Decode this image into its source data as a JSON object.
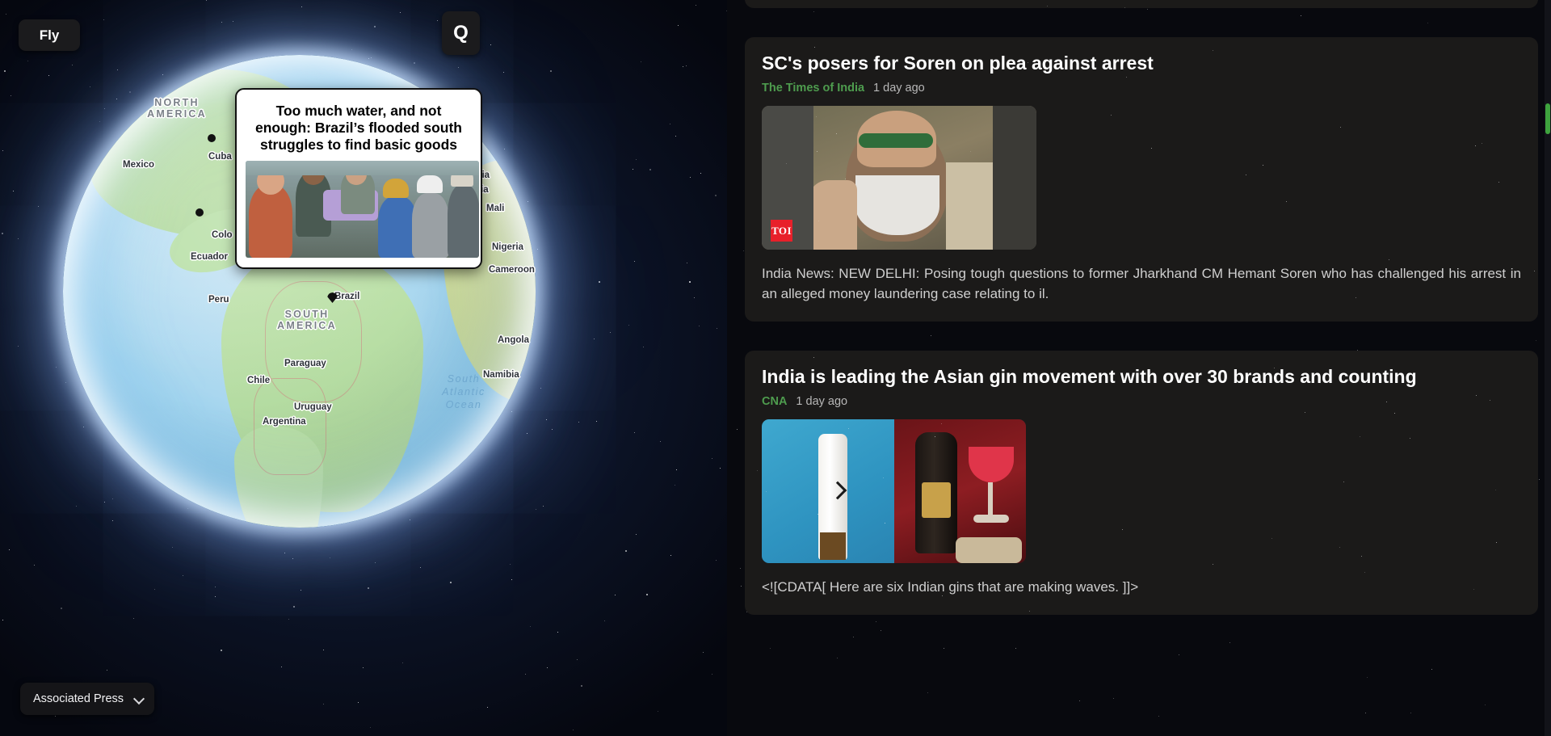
{
  "app": {
    "fly_button": "Fly",
    "q_button": "Q",
    "source_select": {
      "value": "Associated Press",
      "chevron_icon": "chevron-down-icon"
    },
    "accent_green": "#4e9c4e",
    "panel_background": "#1b1a19",
    "scrollbar_color": "#3ea33e"
  },
  "map": {
    "popup": {
      "title": "Too much water, and not enough: Brazil’s flooded south struggles to find basic goods",
      "image_alt": "Rescue workers and residents seated in a boat during flooding"
    },
    "continent_labels": [
      {
        "text": "NORTH AMERICA",
        "line1": "NORTH",
        "line2": "AMERICA"
      },
      {
        "text": "SOUTH AMERICA",
        "line1": "SOUTH",
        "line2": "AMERICA"
      }
    ],
    "ocean_labels": [
      {
        "line1": "South",
        "line2": "Atlantic",
        "line3": "Ocean"
      }
    ],
    "country_labels": [
      "Mexico",
      "Cuba",
      "Colo",
      "Ecuador",
      "Peru",
      "Brazil",
      "Paraguay",
      "Chile",
      "Uruguay",
      "Argentina",
      "ria",
      "nia",
      "Mali",
      "Nigeria",
      "Cameroon",
      "Angola",
      "Namibia"
    ]
  },
  "news": {
    "articles": [
      {
        "title": "SC's posers for Soren on plea against arrest",
        "source": "The Times of India",
        "time": "1 day ago",
        "badge": "TOI",
        "description": "India News: NEW DELHI: Posing tough questions to former Jharkhand CM Hemant Soren who has challenged his arrest in an alleged money laundering case relating to il.",
        "image_alt": "Bearded man with glasses speaking, flanked by security personnel"
      },
      {
        "title": "India is leading the Asian gin movement with over 30 brands and counting",
        "source": "CNA",
        "time": "1 day ago",
        "description": "<![CDATA[ Here are six Indian gins that are making waves. ]]>",
        "image_alt": "Gin bottle against blue water and a dark craft gin bottle with cocktails",
        "carousel_next_icon": "chevron-right-icon"
      }
    ]
  }
}
